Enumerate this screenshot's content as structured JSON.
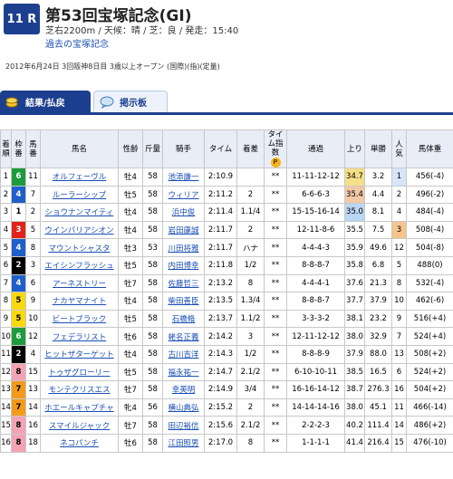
{
  "header": {
    "race_num": "11 R",
    "title": "第53回宝塚記念(GI)",
    "info": "芝右2200m / 天候：晴 / 芝：良 / 発走：15:40",
    "past_link": "過去の宝塚記念",
    "date_line": "2012年6月24日 3回阪神8日目 3歳以上オープン (国際)(指)(定量)"
  },
  "tabs": [
    {
      "label": "結果/払戻"
    },
    {
      "label": "掲示板"
    }
  ],
  "columns": [
    "着順",
    "枠番",
    "馬番",
    "馬名",
    "性齢",
    "斤量",
    "騎手",
    "タイム",
    "着差",
    "タイム指数",
    "通過",
    "上り",
    "単勝",
    "人気",
    "馬体重"
  ],
  "rows": [
    {
      "rank": "1",
      "waku": "6",
      "num": "11",
      "name": "オルフェーヴル",
      "sex": "牡4",
      "weight": "58",
      "jockey": "池添謙一",
      "time": "2:10.9",
      "margin": "",
      "idx": "**",
      "pass": "11-11-12-12",
      "last": "34.7",
      "odds": "3.2",
      "pop": "1",
      "body": "456(-4)"
    },
    {
      "rank": "2",
      "waku": "4",
      "num": "7",
      "name": "ルーラーシップ",
      "sex": "牡5",
      "weight": "58",
      "jockey": "ウィリア",
      "time": "2:11.2",
      "margin": "2",
      "idx": "**",
      "pass": "6-6-6-3",
      "last": "35.4",
      "odds": "4.4",
      "pop": "2",
      "body": "496(-2)"
    },
    {
      "rank": "3",
      "waku": "1",
      "num": "2",
      "name": "ショウナンマイティ",
      "sex": "牡4",
      "weight": "58",
      "jockey": "浜中俊",
      "time": "2:11.4",
      "margin": "1.1/4",
      "idx": "**",
      "pass": "15-15-16-14",
      "last": "35.0",
      "odds": "8.1",
      "pop": "4",
      "body": "484(-4)"
    },
    {
      "rank": "4",
      "waku": "3",
      "num": "5",
      "name": "ウインバリアシオン",
      "sex": "牡4",
      "weight": "58",
      "jockey": "岩田康誠",
      "time": "2:11.7",
      "margin": "2",
      "idx": "**",
      "pass": "12-11-8-6",
      "last": "35.5",
      "odds": "7.5",
      "pop": "3",
      "body": "508(-4)"
    },
    {
      "rank": "5",
      "waku": "4",
      "num": "8",
      "name": "マウントシャスタ",
      "sex": "牡3",
      "weight": "53",
      "jockey": "川田将雅",
      "time": "2:11.7",
      "margin": "ハナ",
      "idx": "**",
      "pass": "4-4-4-3",
      "last": "35.9",
      "odds": "49.6",
      "pop": "12",
      "body": "504(-8)"
    },
    {
      "rank": "6",
      "waku": "2",
      "num": "3",
      "name": "エイシンフラッシュ",
      "sex": "牡5",
      "weight": "58",
      "jockey": "内田博幸",
      "time": "2:11.8",
      "margin": "1/2",
      "idx": "**",
      "pass": "8-8-8-7",
      "last": "35.8",
      "odds": "6.8",
      "pop": "5",
      "body": "488(0)"
    },
    {
      "rank": "7",
      "waku": "4",
      "num": "6",
      "name": "アーネストリー",
      "sex": "牡7",
      "weight": "58",
      "jockey": "佐藤哲三",
      "time": "2:13.2",
      "margin": "8",
      "idx": "**",
      "pass": "4-4-4-1",
      "last": "37.6",
      "odds": "21.3",
      "pop": "8",
      "body": "532(-4)"
    },
    {
      "rank": "8",
      "waku": "5",
      "num": "9",
      "name": "ナカヤマナイト",
      "sex": "牡4",
      "weight": "58",
      "jockey": "柴田善臣",
      "time": "2:13.5",
      "margin": "1.3/4",
      "idx": "**",
      "pass": "8-8-8-7",
      "last": "37.7",
      "odds": "37.9",
      "pop": "10",
      "body": "462(-6)"
    },
    {
      "rank": "9",
      "waku": "5",
      "num": "10",
      "name": "ビートブラック",
      "sex": "牡5",
      "weight": "58",
      "jockey": "石橋脩",
      "time": "2:13.7",
      "margin": "1.1/2",
      "idx": "**",
      "pass": "3-3-3-2",
      "last": "38.1",
      "odds": "23.2",
      "pop": "9",
      "body": "516(+4)"
    },
    {
      "rank": "10",
      "waku": "6",
      "num": "12",
      "name": "フェデラリスト",
      "sex": "牡6",
      "weight": "58",
      "jockey": "蛯名正義",
      "time": "2:14.2",
      "margin": "3",
      "idx": "**",
      "pass": "12-11-12-12",
      "last": "38.0",
      "odds": "32.9",
      "pop": "7",
      "body": "524(+4)"
    },
    {
      "rank": "11",
      "waku": "2",
      "num": "4",
      "name": "ヒットザターゲット",
      "sex": "牡4",
      "weight": "58",
      "jockey": "古川吉洋",
      "time": "2:14.3",
      "margin": "1/2",
      "idx": "**",
      "pass": "8-8-8-9",
      "last": "37.9",
      "odds": "88.0",
      "pop": "13",
      "body": "508(+2)"
    },
    {
      "rank": "12",
      "waku": "8",
      "num": "15",
      "name": "トゥザグローリー",
      "sex": "牡5",
      "weight": "58",
      "jockey": "福永祐一",
      "time": "2:14.7",
      "margin": "2.1/2",
      "idx": "**",
      "pass": "6-10-10-11",
      "last": "38.5",
      "odds": "16.5",
      "pop": "6",
      "body": "524(+2)"
    },
    {
      "rank": "13",
      "waku": "7",
      "num": "13",
      "name": "モンテクリスエス",
      "sex": "牡7",
      "weight": "58",
      "jockey": "幸英明",
      "time": "2:14.9",
      "margin": "3/4",
      "idx": "**",
      "pass": "16-16-14-12",
      "last": "38.7",
      "odds": "276.3",
      "pop": "16",
      "body": "504(+2)"
    },
    {
      "rank": "14",
      "waku": "7",
      "num": "14",
      "name": "ホエールキャプチャ",
      "sex": "牝4",
      "weight": "56",
      "jockey": "横山典弘",
      "time": "2:15.2",
      "margin": "2",
      "idx": "**",
      "pass": "14-14-14-16",
      "last": "38.0",
      "odds": "45.1",
      "pop": "11",
      "body": "466(-14)"
    },
    {
      "rank": "15",
      "waku": "8",
      "num": "16",
      "name": "スマイルジャック",
      "sex": "牡7",
      "weight": "58",
      "jockey": "田辺裕信",
      "time": "2:15.6",
      "margin": "2.1/2",
      "idx": "**",
      "pass": "2-2-2-3",
      "last": "40.2",
      "odds": "111.4",
      "pop": "14",
      "body": "486(+2)"
    },
    {
      "rank": "16",
      "waku": "8",
      "num": "18",
      "name": "ネコパンチ",
      "sex": "牡6",
      "weight": "58",
      "jockey": "江田照男",
      "time": "2:17.0",
      "margin": "8",
      "idx": "**",
      "pass": "1-1-1-1",
      "last": "41.4",
      "odds": "216.4",
      "pop": "15",
      "body": "476(-10)"
    }
  ]
}
